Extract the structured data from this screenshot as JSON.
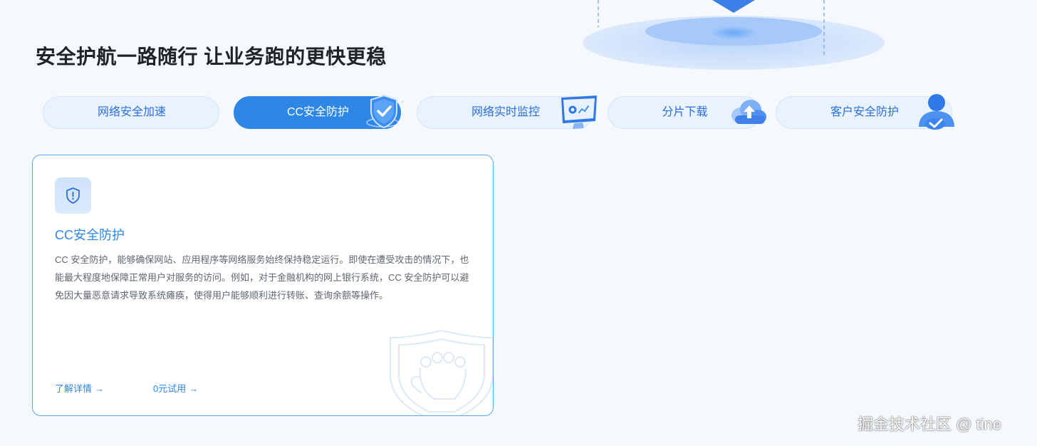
{
  "header": {
    "title": "安全护航一路随行 让业务跑的更快更稳"
  },
  "tabs": [
    {
      "label": "网络安全加速",
      "active": false
    },
    {
      "label": "CC安全防护",
      "active": true,
      "icon": "shield-check-icon"
    },
    {
      "label": "网络实时监控",
      "active": false,
      "icon": "monitor-icon"
    },
    {
      "label": "分片下载",
      "active": false,
      "icon": "cloud-upload-icon"
    },
    {
      "label": "客户安全防护",
      "active": false,
      "icon": "user-check-icon"
    }
  ],
  "card": {
    "icon": "shield-alert-icon",
    "title": "CC安全防护",
    "description": "CC 安全防护，能够确保网站、应用程序等网络服务始终保持稳定运行。即使在遭受攻击的情况下，也能最大程度地保障正常用户对服务的访问。例如，对于金融机构的网上银行系统，CC 安全防护可以避免因大量恶意请求导致系统瘫痪，使得用户能够顺利进行转账、查询余额等操作。",
    "link_details": "了解详情",
    "link_trial": "0元试用",
    "arrow": "→"
  },
  "watermark": "掘金技术社区 @ tine",
  "colors": {
    "accent": "#2e86e5",
    "tab_bg": "#e9f2ff",
    "title_text": "#1f2329",
    "page_bg": "#f6f9fc"
  }
}
